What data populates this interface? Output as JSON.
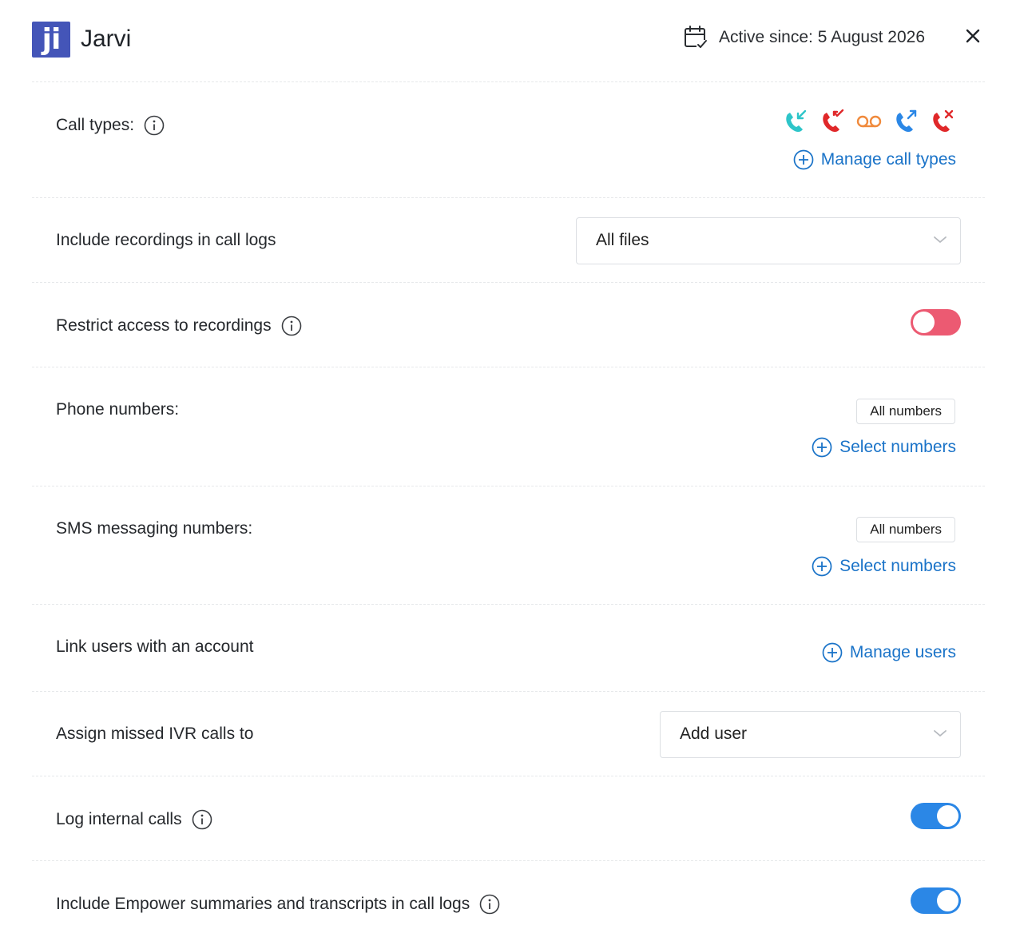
{
  "header": {
    "logo_text": "ji",
    "app_name": "Jarvi",
    "active_since": "Active since: 5 August 2026"
  },
  "settings": {
    "call_types": {
      "label": "Call types:",
      "icons": [
        "incoming-call-icon",
        "missed-call-icon",
        "voicemail-icon",
        "outgoing-call-icon",
        "rejected-call-icon"
      ],
      "icon_colors": [
        "#2ec5c9",
        "#e0282a",
        "#f08a3c",
        "#2b87e6",
        "#e0282a"
      ],
      "manage_label": "Manage call types"
    },
    "recordings": {
      "label": "Include recordings in call logs",
      "selected": "All files"
    },
    "restrict_access": {
      "label": "Restrict access to recordings",
      "enabled": false
    },
    "phone_numbers": {
      "label": "Phone numbers:",
      "chip": "All numbers",
      "action_label": "Select numbers"
    },
    "sms_numbers": {
      "label": "SMS messaging numbers:",
      "chip": "All numbers",
      "action_label": "Select numbers"
    },
    "link_users": {
      "label": "Link users with an account",
      "action_label": "Manage users"
    },
    "missed_ivr": {
      "label": "Assign missed IVR calls to",
      "selected": "Add user"
    },
    "log_internal": {
      "label": "Log internal calls",
      "enabled": true
    },
    "empower": {
      "label": "Include Empower summaries and transcripts in call logs",
      "enabled": true
    }
  },
  "colors": {
    "brand": "#4455b8",
    "link": "#1a73c8",
    "toggle_on": "#2b87e6",
    "toggle_off": "#ec5a72"
  }
}
